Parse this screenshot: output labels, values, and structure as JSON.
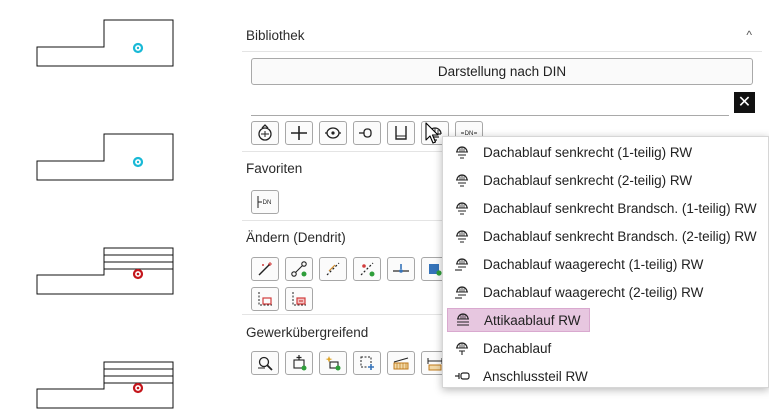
{
  "panel": {
    "library_title": "Bibliothek",
    "collapse_glyph": "^",
    "din_button_label": "Darstellung nach DIN",
    "search": {
      "value": "",
      "placeholder": ""
    },
    "clear_glyph": "✕",
    "library_toolbar": [
      "roof-drain-icon",
      "pipe-cross-icon",
      "valve-icon",
      "connector-icon",
      "trap-icon",
      "roof-drain-dome-icon",
      "din-label-icon"
    ],
    "din_small_text": "DN",
    "favorites_title": "Favoriten",
    "favorites_toolbar": [
      "din-fitting-icon"
    ],
    "modify_title": "Ändern (Dendrit)",
    "modify_toolbar_row1": [
      "magic-route-icon",
      "connect-nodes-icon",
      "dashed-route-icon",
      "split-route-icon",
      "insert-fitting-icon",
      "layer-icon"
    ],
    "modify_toolbar_row2": [
      "dashed-box-delete-icon",
      "dashed-box-remove-icon"
    ],
    "crossdisciplinary_title": "Gewerkübergreifend",
    "crossdisciplinary_toolbar": [
      "wrench-icon",
      "add-node-icon",
      "star-node-icon",
      "grid-add-icon",
      "roof-section-icon",
      "dimension-icon"
    ]
  },
  "dropdown": {
    "items": [
      {
        "label": "Dachablauf senkrecht (1-teilig) RW",
        "icon": "roof-drain-icon",
        "selected": false
      },
      {
        "label": "Dachablauf senkrecht (2-teilig) RW",
        "icon": "roof-drain-icon",
        "selected": false
      },
      {
        "label": "Dachablauf senkrecht Brandsch. (1-teilig) RW",
        "icon": "roof-drain-icon",
        "selected": false
      },
      {
        "label": "Dachablauf senkrecht Brandsch. (2-teilig) RW",
        "icon": "roof-drain-icon",
        "selected": false
      },
      {
        "label": "Dachablauf waagerecht (1-teilig) RW",
        "icon": "roof-drain-side-icon",
        "selected": false
      },
      {
        "label": "Dachablauf waagerecht (2-teilig) RW",
        "icon": "roof-drain-side-icon",
        "selected": false
      },
      {
        "label": "Attikaablauf RW",
        "icon": "parapet-drain-icon",
        "selected": true
      },
      {
        "label": "Dachablauf",
        "icon": "roof-drain-icon",
        "selected": false
      },
      {
        "label": "Anschlussteil RW",
        "icon": "connection-piece-icon",
        "selected": false
      }
    ]
  },
  "colors": {
    "accent_cyan": "#19b9d6",
    "accent_red": "#c4161c",
    "selection": "#e7c7e0",
    "green_dot": "#2e9e3a"
  }
}
